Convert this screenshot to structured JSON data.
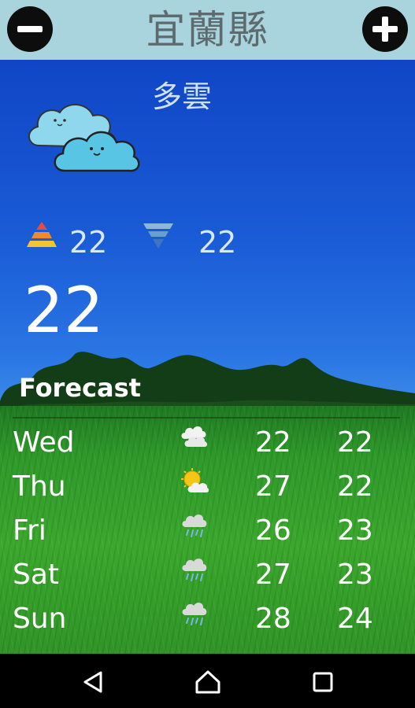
{
  "header": {
    "title": "宜蘭縣",
    "remove_icon": "minus-circle-icon",
    "add_icon": "plus-circle-icon"
  },
  "current": {
    "condition": "多雲",
    "condition_icon": "cloudy-icon",
    "high": "22",
    "low": "22",
    "temperature": "22"
  },
  "forecast": {
    "label": "Forecast",
    "days": [
      {
        "day": "Wed",
        "icon": "cloudy-icon",
        "high": "22",
        "low": "22"
      },
      {
        "day": "Thu",
        "icon": "partly-sunny-icon",
        "high": "27",
        "low": "22"
      },
      {
        "day": "Fri",
        "icon": "rain-icon",
        "high": "26",
        "low": "23"
      },
      {
        "day": "Sat",
        "icon": "rain-icon",
        "high": "27",
        "low": "23"
      },
      {
        "day": "Sun",
        "icon": "rain-icon",
        "high": "28",
        "low": "24"
      }
    ]
  },
  "navbar": {
    "back_icon": "back-triangle-icon",
    "home_icon": "home-icon",
    "recents_icon": "recents-square-icon"
  }
}
